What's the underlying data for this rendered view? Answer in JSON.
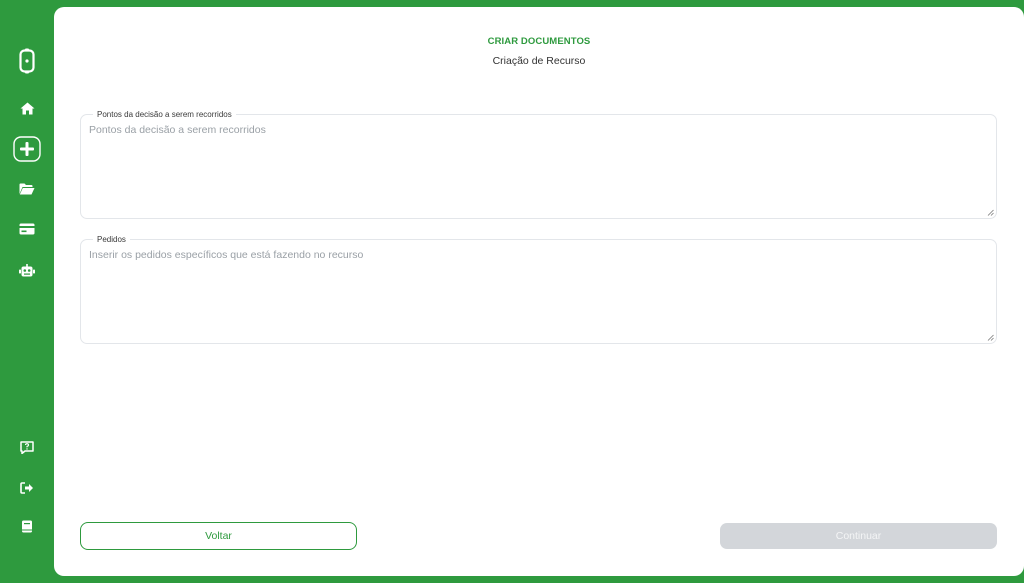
{
  "sidebar": {
    "icons": [
      {
        "name": "app-logo-icon"
      },
      {
        "name": "home-icon"
      },
      {
        "name": "add-document-icon"
      },
      {
        "name": "folder-open-icon"
      },
      {
        "name": "credit-card-icon"
      },
      {
        "name": "robot-icon"
      },
      {
        "name": "help-chat-icon"
      },
      {
        "name": "logout-icon"
      },
      {
        "name": "book-icon"
      }
    ]
  },
  "header": {
    "title": "CRIAR DOCUMENTOS",
    "subtitle": "Criação de Recurso"
  },
  "fields": [
    {
      "label": "Pontos da decisão a serem recorridos",
      "placeholder": "Pontos da decisão a serem recorridos"
    },
    {
      "label": "Pedidos",
      "placeholder": "Inserir os pedidos específicos que está fazendo no recurso"
    }
  ],
  "buttons": {
    "back": "Voltar",
    "continue": "Continuar"
  },
  "colors": {
    "brand": "#2e9a3e",
    "disabled_button": "#d3d6da"
  }
}
